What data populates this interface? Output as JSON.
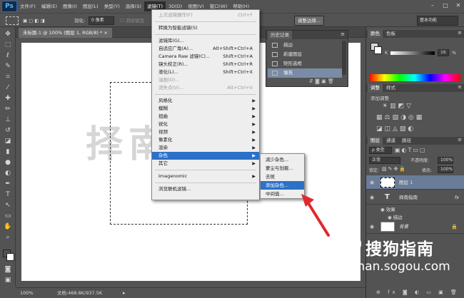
{
  "app": {
    "logo": "Ps"
  },
  "menubar": {
    "items": [
      "文件(F)",
      "编辑(E)",
      "图像(I)",
      "图层(L)",
      "类型(Y)",
      "选择(S)",
      "滤镜(T)",
      "3D(D)",
      "视图(V)",
      "窗口(W)",
      "帮助(H)"
    ],
    "active_index": 6,
    "window_controls": [
      "–",
      "□",
      "✕"
    ]
  },
  "optionsbar": {
    "feather_label": "羽化:",
    "feather_value": "0 像素",
    "antialias_label": "消除锯齿",
    "refine_edge_button": "调整边缘...",
    "workspace_value": "基本功能"
  },
  "document": {
    "tab_title": "未标题-1 @ 100% (图层 1, RGB/8) *",
    "tab_close": "×",
    "watermark_text": "择南"
  },
  "statusbar": {
    "zoom": "100%",
    "doc_info": "文档:468.8K/937.5K"
  },
  "filter_menu": {
    "items": [
      {
        "label": "上次滤镜操作(F)",
        "shortcut": "Ctrl+F",
        "disabled": true
      },
      {
        "sep": true
      },
      {
        "label": "转换为智能滤镜(S)"
      },
      {
        "sep": true
      },
      {
        "label": "滤镜库(G)..."
      },
      {
        "label": "自适应广角(A)...",
        "shortcut": "Alt+Shift+Ctrl+A"
      },
      {
        "label": "Camera Raw 滤镜(C)...",
        "shortcut": "Shift+Ctrl+A"
      },
      {
        "label": "镜头校正(R)...",
        "shortcut": "Shift+Ctrl+R"
      },
      {
        "label": "液化(L)...",
        "shortcut": "Shift+Ctrl+X"
      },
      {
        "label": "油画(O)...",
        "disabled": true
      },
      {
        "label": "消失点(V)...",
        "shortcut": "Alt+Ctrl+V",
        "disabled": true
      },
      {
        "sep": true
      },
      {
        "label": "风格化",
        "submenu": true
      },
      {
        "label": "模糊",
        "submenu": true
      },
      {
        "label": "扭曲",
        "submenu": true
      },
      {
        "label": "锐化",
        "submenu": true
      },
      {
        "label": "视频",
        "submenu": true
      },
      {
        "label": "像素化",
        "submenu": true
      },
      {
        "label": "渲染",
        "submenu": true
      },
      {
        "label": "杂色",
        "submenu": true,
        "highlighted": true
      },
      {
        "label": "其它",
        "submenu": true
      },
      {
        "sep": true
      },
      {
        "label": "Imagenomic",
        "submenu": true
      },
      {
        "sep": true
      },
      {
        "label": "浏览联机滤镜..."
      }
    ]
  },
  "noise_submenu": {
    "items": [
      {
        "label": "减少杂色..."
      },
      {
        "label": "蒙尘与划痕..."
      },
      {
        "label": "去斑"
      },
      {
        "label": "添加杂色...",
        "highlighted": true
      },
      {
        "label": "中间值..."
      }
    ]
  },
  "history_panel": {
    "tabs": [
      "历史记录"
    ],
    "rows": [
      {
        "label": "描边",
        "selected": false
      },
      {
        "label": "新建图层",
        "selected": false
      },
      {
        "label": "矩形选框",
        "selected": false
      },
      {
        "label": "填充",
        "selected": true
      }
    ]
  },
  "color_panel": {
    "tabs": [
      "颜色",
      "色板"
    ],
    "k_label": "K",
    "k_value": "16",
    "k_unit": "%",
    "fg_color": "#d6d6d6",
    "bg_color": "#ffffff"
  },
  "adjust_panel": {
    "tabs": [
      "调整",
      "样式"
    ],
    "title": "添加调整"
  },
  "layers_panel": {
    "tabs": [
      "图层",
      "通道",
      "路径"
    ],
    "kind_label": "ρ 类型",
    "blend_mode": "正常",
    "opacity_label": "不透明度:",
    "opacity_value": "100%",
    "lock_label": "锁定:",
    "fill_label": "填充:",
    "fill_value": "100%",
    "layers": [
      {
        "name": "图层 1",
        "type": "pixel",
        "selected": true
      },
      {
        "name": "择南指南",
        "type": "text",
        "fx": "fx"
      },
      {
        "name": "效果",
        "type": "effect-group"
      },
      {
        "name": "描边",
        "type": "effect"
      },
      {
        "name": "背景",
        "type": "background",
        "locked": true
      }
    ]
  },
  "sogou": {
    "logo_glyph": "S",
    "brand": "搜狗指南",
    "url": "zhinan.sogou.com"
  },
  "colors": {
    "ui_bg": "#535353",
    "menu_bg": "#eeeeee",
    "highlight": "#2b71c8",
    "arrow": "#e0282d"
  }
}
